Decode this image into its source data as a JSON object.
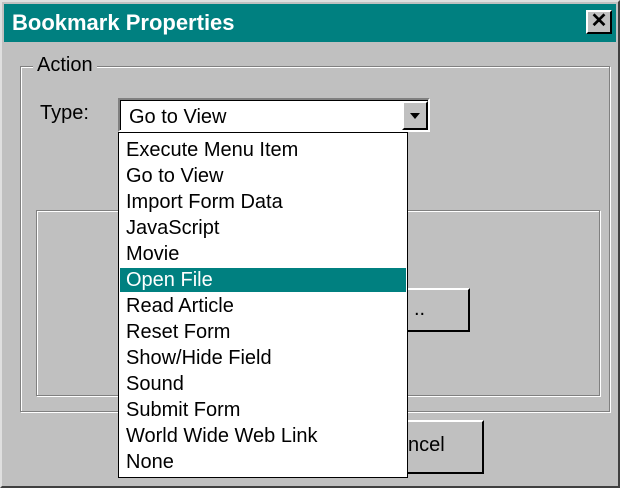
{
  "window": {
    "title": "Bookmark Properties",
    "close_glyph": "✕"
  },
  "action_group": {
    "legend": "Action",
    "type_label": "Type:",
    "type_value": "Go to View",
    "options": [
      "Execute Menu Item",
      "Go to View",
      "Import Form Data",
      "JavaScript",
      "Movie",
      "Open File",
      "Read Article",
      "Reset Form",
      "Show/Hide Field",
      "Sound",
      "Submit Form",
      "World Wide Web Link",
      "None"
    ],
    "highlighted_option": "Open File",
    "partial_button_label": ".."
  },
  "footer": {
    "cancel_visible_label": "ncel"
  },
  "colors": {
    "dialog_face": "#c0c0c0",
    "titlebar": "#008080",
    "selection": "#008080"
  },
  "icons": {
    "close": "close-icon",
    "combo_arrow": "chevron-down-icon"
  }
}
